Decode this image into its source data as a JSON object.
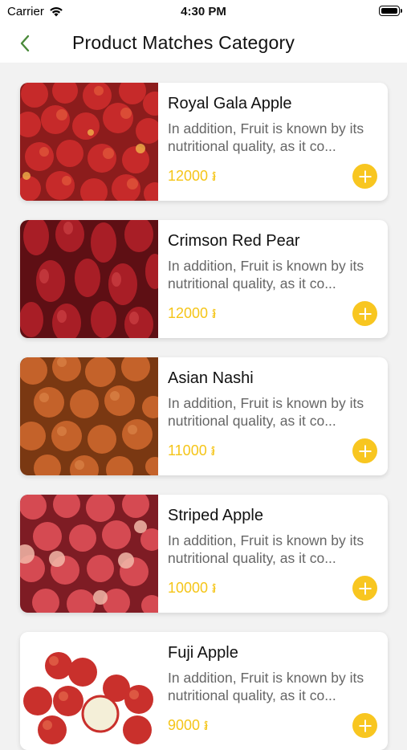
{
  "status_bar": {
    "carrier": "Carrier",
    "time": "4:30 PM"
  },
  "header": {
    "title": "Product Matches Category",
    "back_icon": "chevron-left-icon"
  },
  "colors": {
    "accent": "#f8c620",
    "price": "#f5c518",
    "back": "#4a8a3a"
  },
  "products": [
    {
      "name": "Royal Gala Apple",
      "description": "In addition, Fruit is known by its nutritional quality, as it co...",
      "price": "12000 ៛"
    },
    {
      "name": "Crimson Red Pear",
      "description": "In addition, Fruit is known by its nutritional quality, as it co...",
      "price": "12000 ៛"
    },
    {
      "name": "Asian Nashi",
      "description": "In addition, Fruit is known by its nutritional quality, as it co...",
      "price": "11000 ៛"
    },
    {
      "name": "Striped Apple",
      "description": "In addition, Fruit is known by its nutritional quality, as it co...",
      "price": "10000 ៛"
    },
    {
      "name": "Fuji Apple",
      "description": "In addition, Fruit is known by its nutritional quality, as it co...",
      "price": "9000 ៛"
    }
  ]
}
